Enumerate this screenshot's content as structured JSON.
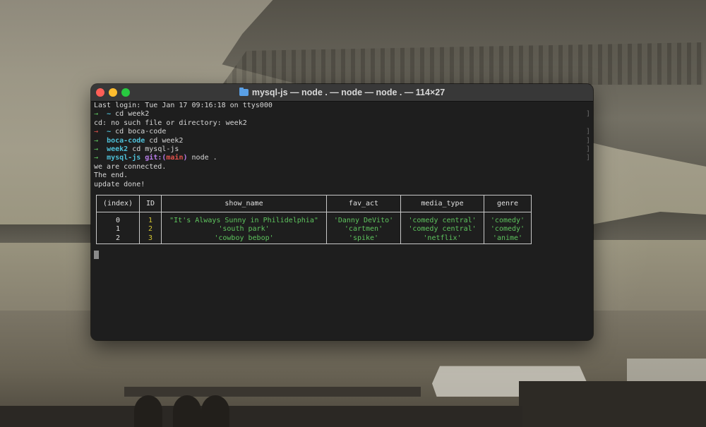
{
  "window": {
    "title": "mysql-js — node . — node — node . — 114×27"
  },
  "terminal": {
    "lines": {
      "last_login": "Last login: Tue Jan 17 09:16:18 on ttys000",
      "cmd1_arrow": "→",
      "cmd1_dir": "~",
      "cmd1_text": " cd week2",
      "err": "cd: no such file or directory: week2",
      "cmd2_arrow": "→",
      "cmd2_dir": "~",
      "cmd2_text": " cd boca-code",
      "cmd3_arrow": "→",
      "cmd3_dir": "boca-code",
      "cmd3_text": " cd week2",
      "cmd4_arrow": "→",
      "cmd4_dir": "week2",
      "cmd4_text": " cd mysql-js",
      "cmd5_arrow": "→",
      "cmd5_dir": "mysql-js",
      "cmd5_git": "git:(",
      "cmd5_branch": "main",
      "cmd5_git_close": ")",
      "cmd5_text": " node .",
      "out1": "we are connected.",
      "out2": "The end.",
      "out3": "update done!"
    },
    "table": {
      "headers": [
        "(index)",
        "ID",
        "show_name",
        "fav_act",
        "media_type",
        "genre"
      ],
      "rows": [
        {
          "index": "0",
          "id": "1",
          "show_name": "\"It's Always Sunny in Philidelphia\"",
          "fav_act": "'Danny DeVito'",
          "media_type": "'comedy central'",
          "genre": "'comedy'"
        },
        {
          "index": "1",
          "id": "2",
          "show_name": "'south park'",
          "fav_act": "'cartmen'",
          "media_type": "'comedy central'",
          "genre": "'comedy'"
        },
        {
          "index": "2",
          "id": "3",
          "show_name": "'cowboy bebop'",
          "fav_act": "'spike'",
          "media_type": "'netflix'",
          "genre": "'anime'"
        }
      ]
    }
  },
  "colors": {
    "prompt_ok": "#5ec45e",
    "prompt_err": "#e0514b",
    "dir": "#4fc1d9",
    "repo_dir": "#b87de8",
    "id_number": "#d4c634",
    "string_value": "#5ec45e"
  }
}
